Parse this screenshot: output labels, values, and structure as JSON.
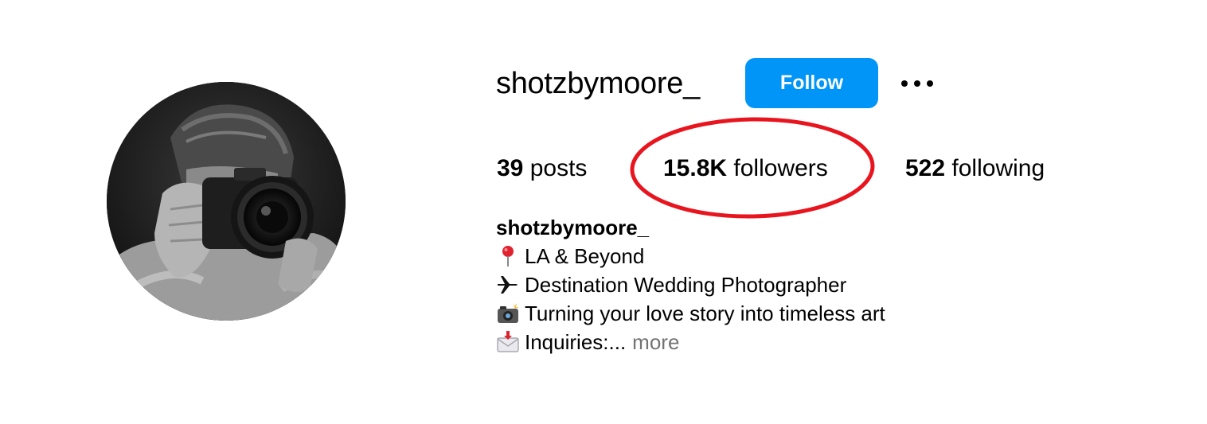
{
  "profile": {
    "username": "shotzbymoore_",
    "follow_label": "Follow",
    "more_options_icon": "more-horizontal-icon",
    "avatar_description_icon": "camera-photographer-avatar"
  },
  "stats": {
    "posts_count": "39",
    "posts_label": "posts",
    "followers_count": "15.8K",
    "followers_label": "followers",
    "following_count": "522",
    "following_label": "following"
  },
  "bio": {
    "name": "shotzbymoore_",
    "lines": [
      {
        "icon": "round-pushpin-icon",
        "text": "LA & Beyond"
      },
      {
        "icon": "airplane-icon",
        "text": "Destination Wedding Photographer"
      },
      {
        "icon": "camera-flash-icon",
        "text": "Turning your love story into timeless art"
      },
      {
        "icon": "envelope-arrow-icon",
        "text": "Inquiries:..."
      }
    ],
    "more_label": "more"
  },
  "colors": {
    "accent": "#0095f6",
    "highlight_circle": "#e8151f",
    "muted_text": "#737373"
  }
}
